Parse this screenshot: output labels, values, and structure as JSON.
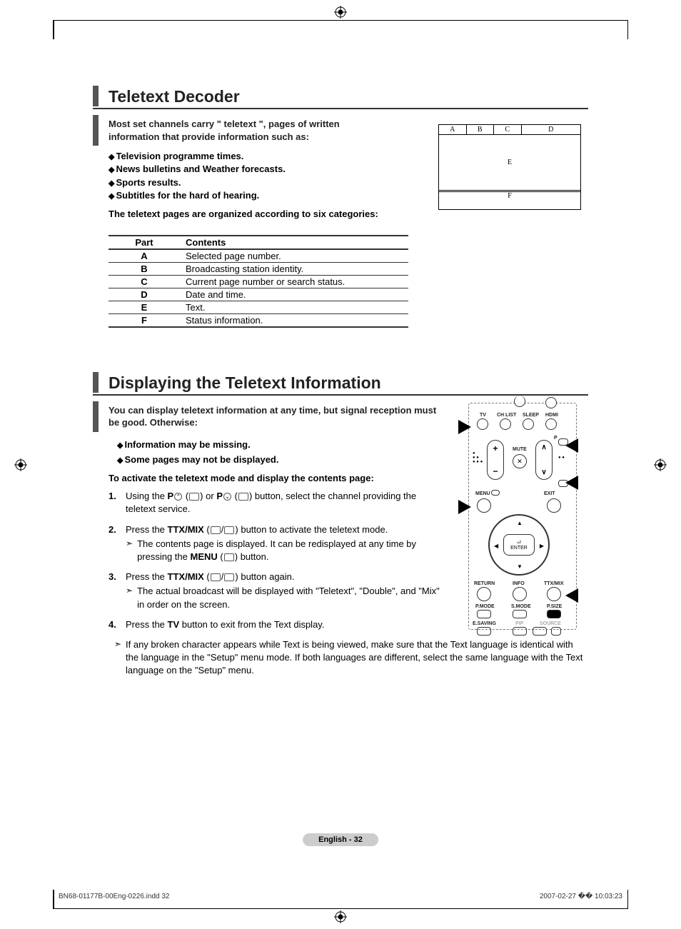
{
  "section1": {
    "title": "Teletext Decoder",
    "intro": "Most set channels carry \" teletext \", pages of written information that provide information such as:",
    "bullets": [
      "Television programme times.",
      "News bulletins and Weather forecasts.",
      "Sports results.",
      "Subtitles for the hard of hearing."
    ],
    "sub_intro": "The teletext pages are organized according to six categories:",
    "table": {
      "head_part": "Part",
      "head_contents": "Contents",
      "rows": [
        {
          "part": "A",
          "contents": "Selected page number."
        },
        {
          "part": "B",
          "contents": "Broadcasting station identity."
        },
        {
          "part": "C",
          "contents": "Current page number or search status."
        },
        {
          "part": "D",
          "contents": "Date and time."
        },
        {
          "part": "E",
          "contents": "Text."
        },
        {
          "part": "F",
          "contents": "Status information."
        }
      ]
    },
    "diagram": {
      "a": "A",
      "b": "B",
      "c": "C",
      "d": "D",
      "e": "E",
      "f": "F"
    }
  },
  "section2": {
    "title": "Displaying the Teletext Information",
    "intro": "You can display teletext information at any time, but signal reception must be good. Otherwise:",
    "bullets": [
      "Information may be missing.",
      "Some pages may not be displayed."
    ],
    "activate": "To activate the teletext mode and display the contents page:",
    "steps": {
      "s1a": "Using the ",
      "s1b": " button, select the channel providing the teletext service.",
      "s2a": "Press the ",
      "s2b": " button to activate the teletext mode.",
      "s2sub": "The contents page is displayed. It can be redisplayed at any time by pressing the ",
      "s2sub2": " button.",
      "s3a": "Press the ",
      "s3b": " button again.",
      "s3sub": "The actual broadcast will be displayed with \"Teletext\", \"Double\", and \"Mix\" in order on the screen.",
      "s4a": "Press the ",
      "s4b": " button to exit from the Text display."
    },
    "note": "If any broken character appears while Text is being viewed, make sure that the Text language is identical with the language in the \"Setup\" menu mode. If both languages are different, select the same language with the Text language on the \"Setup\" menu.",
    "labels": {
      "P": "P",
      "TTXMIX": "TTX/MIX",
      "MENU": "MENU",
      "TV": "TV",
      "or": " or "
    }
  },
  "remote": {
    "top_labels": {
      "tv": "TV",
      "chlist": "CH LIST",
      "sleep": "SLEEP",
      "hdmi": "HDMI"
    },
    "mid_labels": {
      "p": "P",
      "mute": "MUTE",
      "menu": "MENU",
      "exit": "EXIT"
    },
    "enter": "ENTER",
    "bottom_labels": {
      "return": "RETURN",
      "info": "INFO",
      "ttxmix": "TTX/MIX",
      "pmode": "P.MODE",
      "smode": "S.MODE",
      "psize": "P.SIZE",
      "esaving": "E.SAVING",
      "pip": "PIP",
      "source": "SOURCE"
    }
  },
  "page_pill": "English - 32",
  "footer": {
    "left": "BN68-01177B-00Eng-0226.indd   32",
    "right": "2007-02-27   �� 10:03:23"
  }
}
